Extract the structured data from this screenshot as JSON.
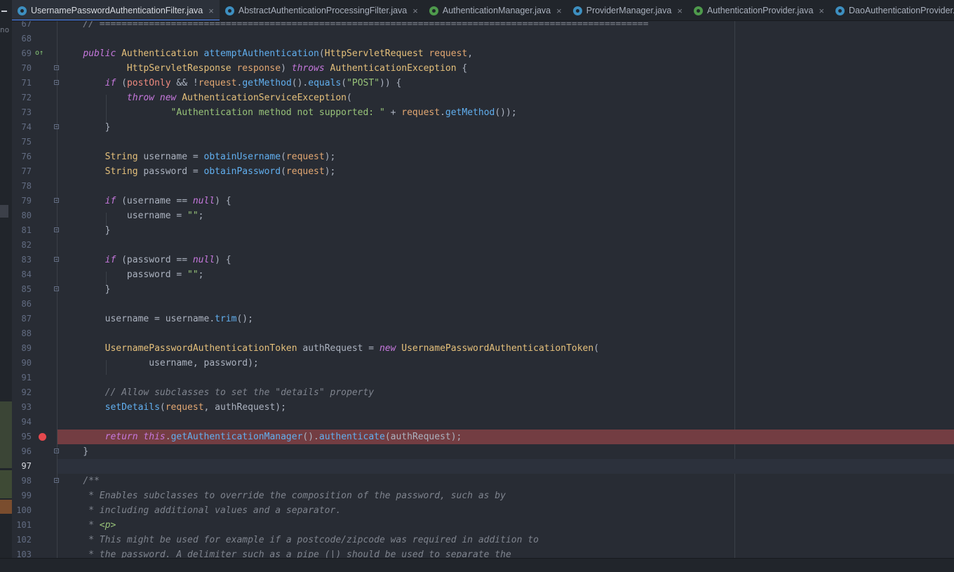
{
  "tabs": [
    {
      "label": "UsernamePasswordAuthenticationFilter.java",
      "icon": "class-icon",
      "active": true,
      "closable": true
    },
    {
      "label": "AbstractAuthenticationProcessingFilter.java",
      "icon": "class-icon",
      "active": false,
      "closable": true
    },
    {
      "label": "AuthenticationManager.java",
      "icon": "interface-icon",
      "active": false,
      "closable": true
    },
    {
      "label": "ProviderManager.java",
      "icon": "class-icon",
      "active": false,
      "closable": true
    },
    {
      "label": "AuthenticationProvider.java",
      "icon": "interface-icon",
      "active": false,
      "closable": true
    },
    {
      "label": "DaoAuthenticationProvider.java",
      "icon": "class-icon",
      "active": false,
      "closable": false
    }
  ],
  "left_panel": {
    "truncated_text": "no"
  },
  "editor": {
    "current_line": 97,
    "breakpoint_line": 95,
    "lines": [
      {
        "n": "67",
        "tokens": [
          [
            "cm",
            "    // ===================================================================================================="
          ]
        ]
      },
      {
        "n": "68",
        "tokens": []
      },
      {
        "n": "69",
        "tokens": [
          [
            "",
            "    "
          ],
          [
            "kw",
            "public"
          ],
          [
            "",
            " "
          ],
          [
            "ty",
            "Authentication"
          ],
          [
            "",
            " "
          ],
          [
            "fn",
            "attemptAuthentication"
          ],
          [
            "",
            "("
          ],
          [
            "ty",
            "HttpServletRequest"
          ],
          [
            "",
            " "
          ],
          [
            "pa",
            "request"
          ],
          [
            "",
            ","
          ]
        ]
      },
      {
        "n": "70",
        "tokens": [
          [
            "",
            "            "
          ],
          [
            "ty",
            "HttpServletResponse"
          ],
          [
            "",
            " "
          ],
          [
            "pa",
            "response"
          ],
          [
            "",
            ") "
          ],
          [
            "kw",
            "throws"
          ],
          [
            "",
            " "
          ],
          [
            "ty",
            "AuthenticationException"
          ],
          [
            "",
            " {"
          ]
        ]
      },
      {
        "n": "71",
        "tokens": [
          [
            "",
            "        "
          ],
          [
            "kw",
            "if"
          ],
          [
            "",
            " ("
          ],
          [
            "fl",
            "postOnly"
          ],
          [
            "",
            " && !"
          ],
          [
            "pa",
            "request"
          ],
          [
            "",
            "."
          ],
          [
            "fn",
            "getMethod"
          ],
          [
            "",
            "()."
          ],
          [
            "fn",
            "equals"
          ],
          [
            "",
            "("
          ],
          [
            "st",
            "\"POST\""
          ],
          [
            "",
            ")) {"
          ]
        ]
      },
      {
        "n": "72",
        "tokens": [
          [
            "",
            "            "
          ],
          [
            "kw",
            "throw"
          ],
          [
            "",
            " "
          ],
          [
            "kw",
            "new"
          ],
          [
            "",
            " "
          ],
          [
            "ty",
            "AuthenticationServiceException"
          ],
          [
            "",
            "("
          ]
        ]
      },
      {
        "n": "73",
        "tokens": [
          [
            "",
            "                    "
          ],
          [
            "st",
            "\"Authentication method not supported: \""
          ],
          [
            "",
            " + "
          ],
          [
            "pa",
            "request"
          ],
          [
            "",
            "."
          ],
          [
            "fn",
            "getMethod"
          ],
          [
            "",
            "());"
          ]
        ]
      },
      {
        "n": "74",
        "tokens": [
          [
            "",
            "        }"
          ]
        ]
      },
      {
        "n": "75",
        "tokens": []
      },
      {
        "n": "76",
        "tokens": [
          [
            "",
            "        "
          ],
          [
            "ty",
            "String"
          ],
          [
            "",
            " username = "
          ],
          [
            "fn",
            "obtainUsername"
          ],
          [
            "",
            "("
          ],
          [
            "pa",
            "request"
          ],
          [
            "",
            ");"
          ]
        ]
      },
      {
        "n": "77",
        "tokens": [
          [
            "",
            "        "
          ],
          [
            "ty",
            "String"
          ],
          [
            "",
            " password = "
          ],
          [
            "fn",
            "obtainPassword"
          ],
          [
            "",
            "("
          ],
          [
            "pa",
            "request"
          ],
          [
            "",
            ");"
          ]
        ]
      },
      {
        "n": "78",
        "tokens": []
      },
      {
        "n": "79",
        "tokens": [
          [
            "",
            "        "
          ],
          [
            "kw",
            "if"
          ],
          [
            "",
            " (username == "
          ],
          [
            "kw",
            "null"
          ],
          [
            "",
            ") {"
          ]
        ]
      },
      {
        "n": "80",
        "tokens": [
          [
            "",
            "            username = "
          ],
          [
            "st",
            "\"\""
          ],
          [
            "",
            ";"
          ]
        ]
      },
      {
        "n": "81",
        "tokens": [
          [
            "",
            "        }"
          ]
        ]
      },
      {
        "n": "82",
        "tokens": []
      },
      {
        "n": "83",
        "tokens": [
          [
            "",
            "        "
          ],
          [
            "kw",
            "if"
          ],
          [
            "",
            " (password == "
          ],
          [
            "kw",
            "null"
          ],
          [
            "",
            ") {"
          ]
        ]
      },
      {
        "n": "84",
        "tokens": [
          [
            "",
            "            password = "
          ],
          [
            "st",
            "\"\""
          ],
          [
            "",
            ";"
          ]
        ]
      },
      {
        "n": "85",
        "tokens": [
          [
            "",
            "        }"
          ]
        ]
      },
      {
        "n": "86",
        "tokens": []
      },
      {
        "n": "87",
        "tokens": [
          [
            "",
            "        username = username."
          ],
          [
            "fn",
            "trim"
          ],
          [
            "",
            "();"
          ]
        ]
      },
      {
        "n": "88",
        "tokens": []
      },
      {
        "n": "89",
        "tokens": [
          [
            "",
            "        "
          ],
          [
            "ty",
            "UsernamePasswordAuthenticationToken"
          ],
          [
            "",
            " authRequest = "
          ],
          [
            "kw",
            "new"
          ],
          [
            "",
            " "
          ],
          [
            "ty",
            "UsernamePasswordAuthenticationToken"
          ],
          [
            "",
            "("
          ]
        ]
      },
      {
        "n": "90",
        "tokens": [
          [
            "",
            "                username, password);"
          ]
        ]
      },
      {
        "n": "91",
        "tokens": []
      },
      {
        "n": "92",
        "tokens": [
          [
            "",
            "        "
          ],
          [
            "cm",
            "// Allow subclasses to set the \"details\" property"
          ]
        ]
      },
      {
        "n": "93",
        "tokens": [
          [
            "",
            "        "
          ],
          [
            "fn",
            "setDetails"
          ],
          [
            "",
            "("
          ],
          [
            "pa",
            "request"
          ],
          [
            "",
            ", authRequest);"
          ]
        ]
      },
      {
        "n": "94",
        "tokens": []
      },
      {
        "n": "95",
        "tokens": [
          [
            "",
            "        "
          ],
          [
            "kw",
            "return"
          ],
          [
            "",
            " "
          ],
          [
            "kw",
            "this"
          ],
          [
            "",
            "."
          ],
          [
            "fn",
            "getAuthenticationManager"
          ],
          [
            "",
            "()."
          ],
          [
            "fn",
            "authenticate"
          ],
          [
            "",
            "(authRequest);"
          ]
        ]
      },
      {
        "n": "96",
        "tokens": [
          [
            "",
            "    }"
          ]
        ]
      },
      {
        "n": "97",
        "tokens": []
      },
      {
        "n": "98",
        "tokens": [
          [
            "cm",
            "    /**"
          ]
        ]
      },
      {
        "n": "99",
        "tokens": [
          [
            "cm",
            "     * Enables subclasses to override the composition of the password, such as by"
          ]
        ]
      },
      {
        "n": "100",
        "tokens": [
          [
            "cm",
            "     * including additional values and a separator."
          ]
        ]
      },
      {
        "n": "101",
        "tokens": [
          [
            "cm",
            "     * "
          ],
          [
            "tg",
            "<p>"
          ]
        ]
      },
      {
        "n": "102",
        "tokens": [
          [
            "cm",
            "     * This might be used for example if a postcode/zipcode was required in addition to"
          ]
        ]
      },
      {
        "n": "103",
        "tokens": [
          [
            "cm",
            "     * the password. A delimiter such as a pipe (|) should be used to separate the"
          ]
        ]
      }
    ]
  }
}
